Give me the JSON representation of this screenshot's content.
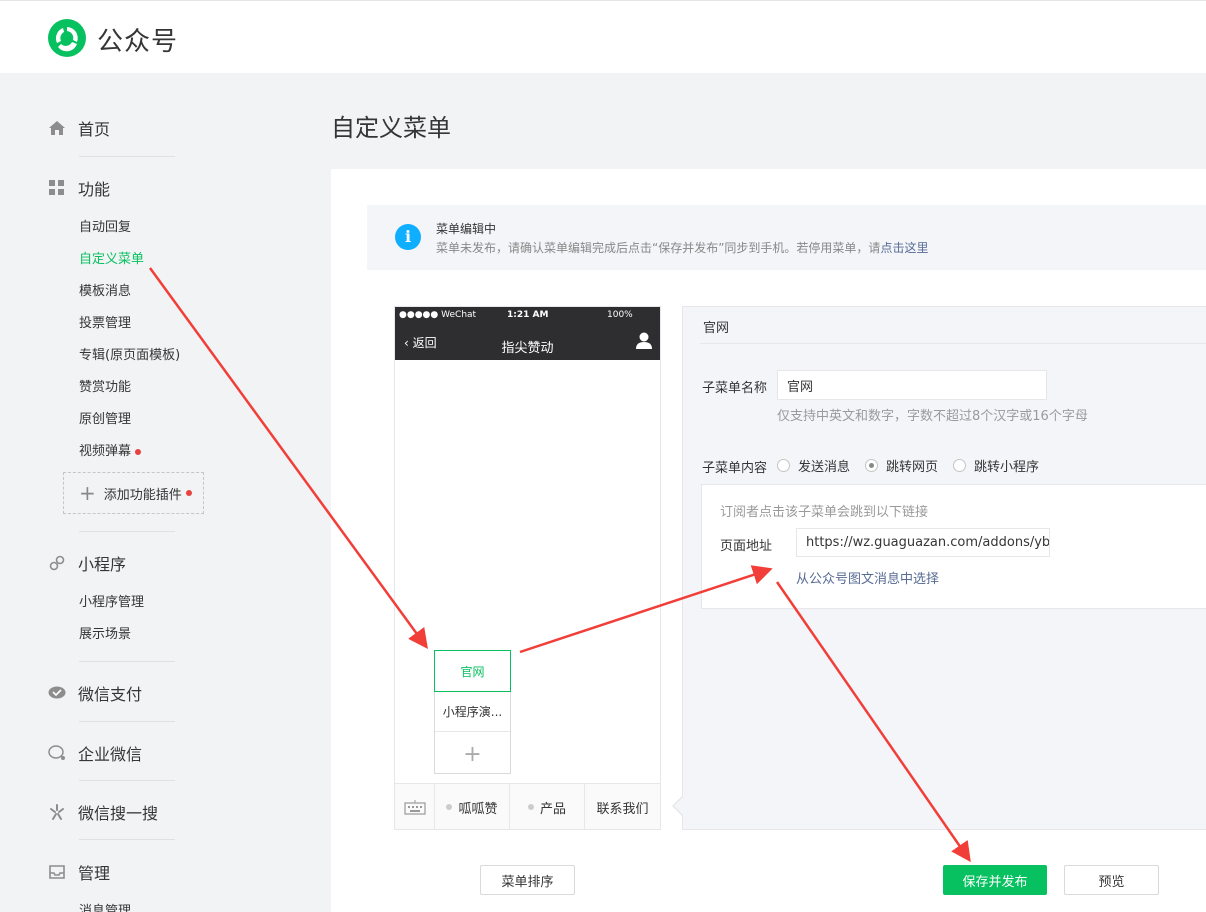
{
  "app": {
    "brand": "公众号"
  },
  "sidebar": {
    "home": "首页",
    "functions": {
      "label": "功能",
      "items": [
        "自动回复",
        "自定义菜单",
        "模板消息",
        "投票管理",
        "专辑(原页面模板)",
        "赞赏功能",
        "原创管理",
        "视频弹幕"
      ],
      "add_plugin": "添加功能插件"
    },
    "miniprogram": {
      "label": "小程序",
      "items": [
        "小程序管理",
        "展示场景"
      ]
    },
    "pay": "微信支付",
    "work": "企业微信",
    "search": "微信搜一搜",
    "manage": {
      "label": "管理",
      "items": [
        "消息管理"
      ]
    }
  },
  "page": {
    "title": "自定义菜单"
  },
  "notice": {
    "title": "菜单编辑中",
    "text": "菜单未发布，请确认菜单编辑完成后点击“保存并发布”同步到手机。若停用菜单，请",
    "link": "点击这里"
  },
  "phone": {
    "carrier": "●●●●● WeChat",
    "time": "1:21 AM",
    "battery": "100%",
    "back": "返回",
    "title": "指尖赞动",
    "submenu": [
      "官网",
      "小程序演..."
    ],
    "bottom_menu": [
      "呱呱赞",
      "产品",
      "联系我们"
    ]
  },
  "editor": {
    "title": "官网",
    "name_label": "子菜单名称",
    "name_value": "官网",
    "name_hint": "仅支持中英文和数字，字数不超过8个汉字或16个字母",
    "content_label": "子菜单内容",
    "options": [
      "发送消息",
      "跳转网页",
      "跳转小程序"
    ],
    "selected_option": "跳转网页",
    "box_hint": "订阅者点击该子菜单会跳到以下链接",
    "url_label": "页面地址",
    "url_value": "https://wz.guaguazan.com/addons/yb_",
    "choose_link": "从公众号图文消息中选择"
  },
  "buttons": {
    "sort": "菜单排序",
    "save": "保存并发布",
    "preview": "预览"
  },
  "colors": {
    "brand_green": "#07c160",
    "annotation_red": "#f23e38",
    "link_blue": "#576b95"
  }
}
